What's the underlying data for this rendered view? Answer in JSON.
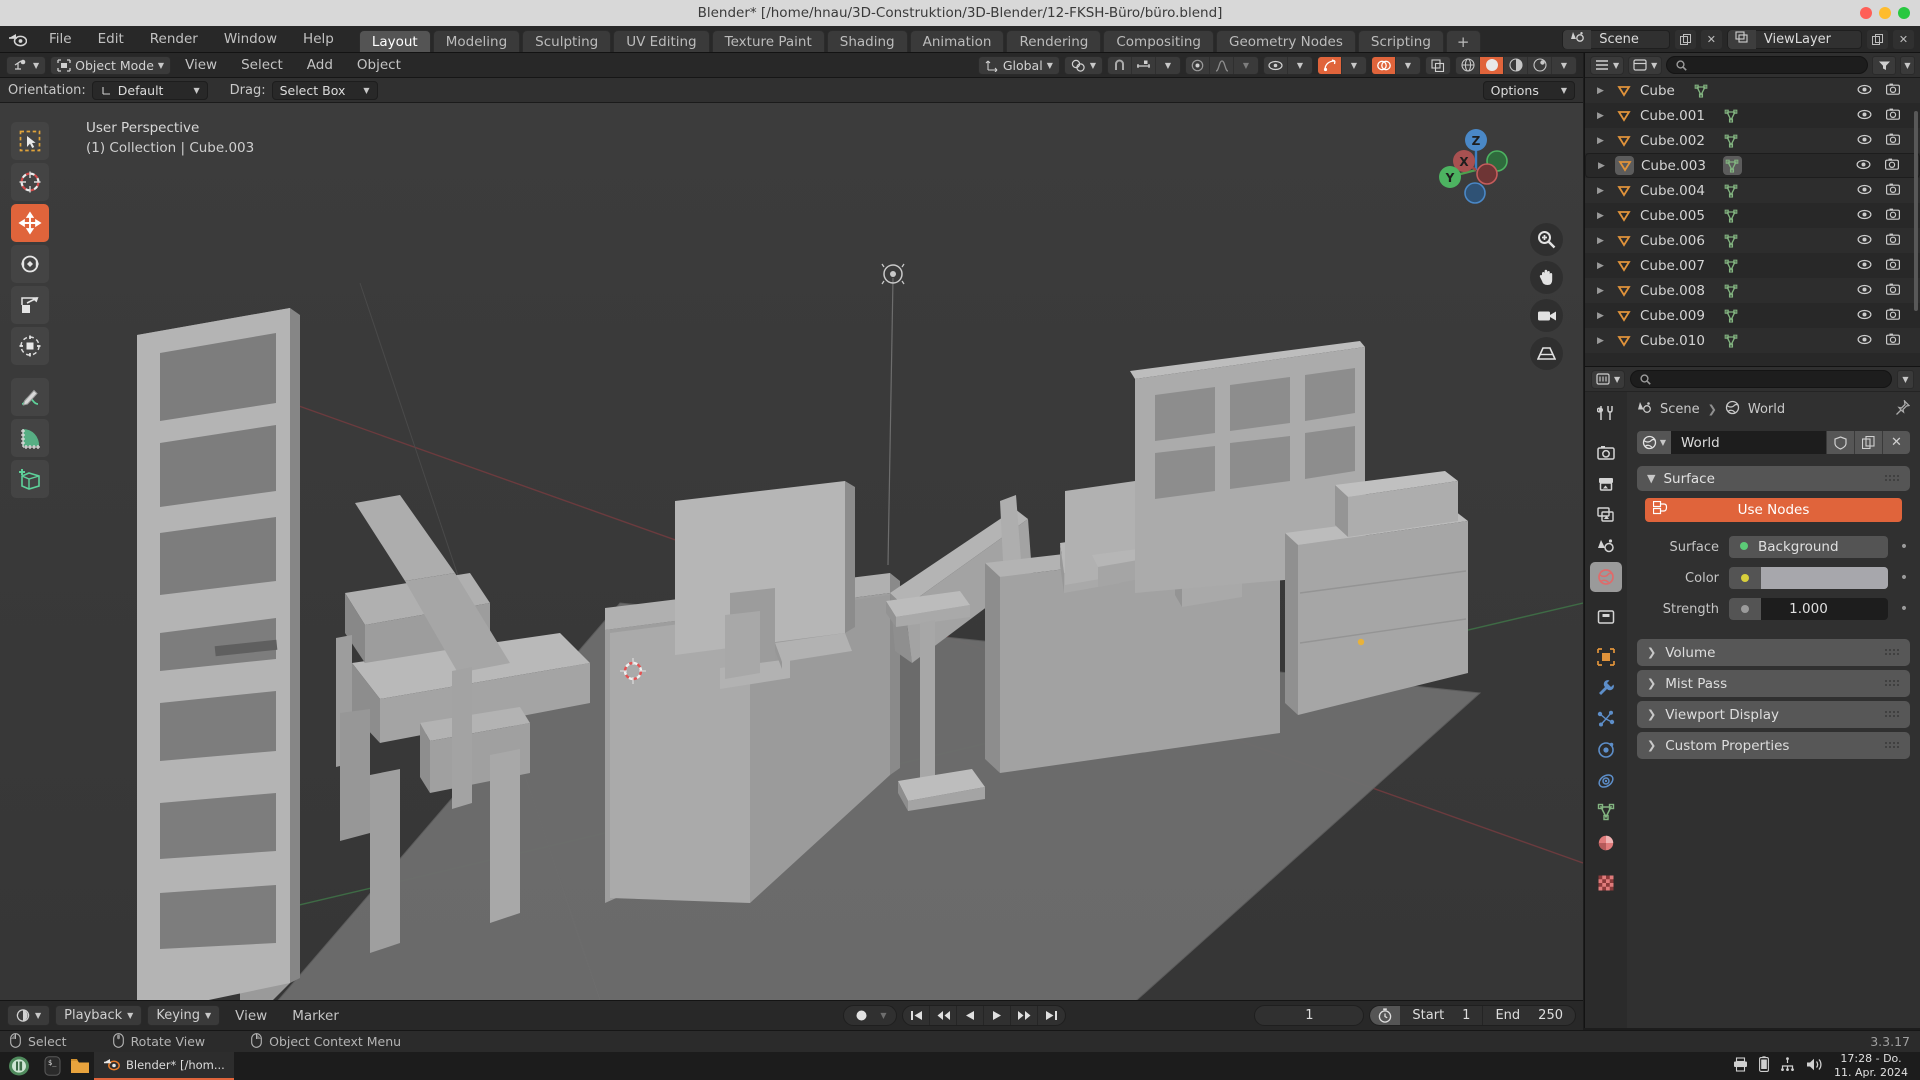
{
  "window": {
    "title": "Blender* [/home/hnau/3D-Construktion/3D-Blender/12-FKSH-Büro/büro.blend]"
  },
  "topbar": {
    "menus": [
      "File",
      "Edit",
      "Render",
      "Window",
      "Help"
    ],
    "workspaces": [
      {
        "label": "Layout",
        "active": true
      },
      {
        "label": "Modeling",
        "active": false
      },
      {
        "label": "Sculpting",
        "active": false
      },
      {
        "label": "UV Editing",
        "active": false
      },
      {
        "label": "Texture Paint",
        "active": false
      },
      {
        "label": "Shading",
        "active": false
      },
      {
        "label": "Animation",
        "active": false
      },
      {
        "label": "Rendering",
        "active": false
      },
      {
        "label": "Compositing",
        "active": false
      },
      {
        "label": "Geometry Nodes",
        "active": false
      },
      {
        "label": "Scripting",
        "active": false
      }
    ],
    "add_workspace_label": "+",
    "scene_name": "Scene",
    "viewlayer_name": "ViewLayer"
  },
  "viewport_header": {
    "editor_type_icon": "editor-type-icon",
    "mode": "Object Mode",
    "menus": [
      "View",
      "Select",
      "Add",
      "Object"
    ],
    "transform_orientation": "Global",
    "proportional_icon": "proportional-editing-icon",
    "snap_icon": "snap-magnet-icon"
  },
  "viewport_row2": {
    "orientation_label": "Orientation:",
    "orientation_value": "Default",
    "drag_label": "Drag:",
    "drag_value": "Select Box",
    "options_label": "Options"
  },
  "viewport": {
    "perspective_label": "User Perspective",
    "collection_label": "(1) Collection | Cube.003",
    "gizmo_axes": [
      "X",
      "Y",
      "Z"
    ],
    "tools": [
      {
        "name": "tweak-select-tool",
        "active": false
      },
      {
        "name": "cursor-tool",
        "active": false
      },
      {
        "name": "move-tool",
        "active": true
      },
      {
        "name": "rotate-tool",
        "active": false
      },
      {
        "name": "scale-tool",
        "active": false
      },
      {
        "name": "transform-tool",
        "active": false
      },
      {
        "name": "annotate-tool",
        "active": false
      },
      {
        "name": "measure-tool",
        "active": false
      },
      {
        "name": "add-cube-tool",
        "active": false
      }
    ]
  },
  "outliner": {
    "search_placeholder": "",
    "items": [
      {
        "name": "Cube",
        "selected": false
      },
      {
        "name": "Cube.001",
        "selected": false
      },
      {
        "name": "Cube.002",
        "selected": false
      },
      {
        "name": "Cube.003",
        "selected": true
      },
      {
        "name": "Cube.004",
        "selected": false
      },
      {
        "name": "Cube.005",
        "selected": false
      },
      {
        "name": "Cube.006",
        "selected": false
      },
      {
        "name": "Cube.007",
        "selected": false
      },
      {
        "name": "Cube.008",
        "selected": false
      },
      {
        "name": "Cube.009",
        "selected": false
      },
      {
        "name": "Cube.010",
        "selected": false
      }
    ]
  },
  "properties": {
    "search_placeholder": "",
    "breadcrumb": [
      "Scene",
      "World"
    ],
    "id_name": "World",
    "panel_surface": "Surface",
    "use_nodes_label": "Use Nodes",
    "rows": [
      {
        "label": "Surface",
        "value": "Background",
        "kind": "enum"
      },
      {
        "label": "Color",
        "value": "",
        "kind": "color"
      },
      {
        "label": "Strength",
        "value": "1.000",
        "kind": "number"
      }
    ],
    "subpanels": [
      "Volume",
      "Mist Pass",
      "Viewport Display",
      "Custom Properties"
    ],
    "accent_color": "#e0643b",
    "tabs": [
      {
        "name": "tool-tab",
        "active": false
      },
      {
        "name": "render-tab",
        "active": false
      },
      {
        "name": "output-tab",
        "active": false
      },
      {
        "name": "view-layer-tab",
        "active": false
      },
      {
        "name": "scene-tab",
        "active": false
      },
      {
        "name": "world-tab",
        "active": true
      },
      {
        "name": "collection-tab",
        "active": false
      },
      {
        "name": "object-tab",
        "active": false
      },
      {
        "name": "modifier-tab",
        "active": false
      },
      {
        "name": "particles-tab",
        "active": false
      },
      {
        "name": "physics-tab",
        "active": false
      },
      {
        "name": "constraints-tab",
        "active": false
      },
      {
        "name": "data-tab",
        "active": false
      },
      {
        "name": "material-tab",
        "active": false
      },
      {
        "name": "texture-tab",
        "active": false
      }
    ]
  },
  "timeline": {
    "playback_label": "Playback",
    "keying_label": "Keying",
    "view_label": "View",
    "marker_label": "Marker",
    "current_frame": "1",
    "start_label": "Start",
    "start_value": "1",
    "end_label": "End",
    "end_value": "250"
  },
  "statusbar": {
    "items": [
      {
        "icon": "mouse-left-icon",
        "label": "Select"
      },
      {
        "icon": "mouse-middle-icon",
        "label": "Rotate View"
      },
      {
        "icon": "mouse-right-icon",
        "label": "Object Context Menu"
      }
    ],
    "version": "3.3.17"
  },
  "taskbar": {
    "window_label": "Blender* [/hom...",
    "time": "17:28 - Do.",
    "date": "11. Apr. 2024"
  }
}
